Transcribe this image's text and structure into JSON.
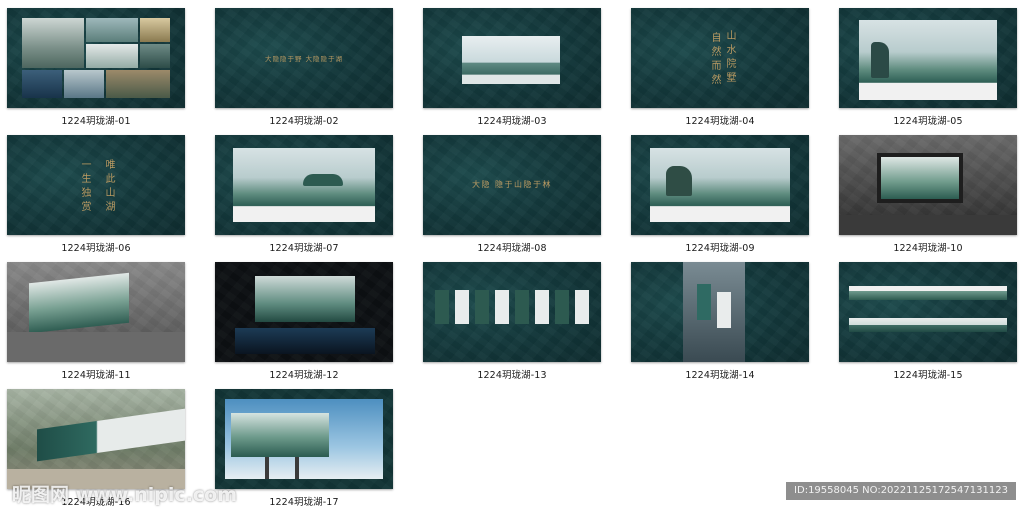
{
  "files": [
    {
      "label": "1224玥珑湖-01"
    },
    {
      "label": "1224玥珑湖-02",
      "text": "大隐隐于野 大隐隐于湖"
    },
    {
      "label": "1224玥珑湖-03"
    },
    {
      "label": "1224玥珑湖-04",
      "col1": "自然而然",
      "col2": "山水院墅"
    },
    {
      "label": "1224玥珑湖-05"
    },
    {
      "label": "1224玥珑湖-06",
      "col1": "一生独赏",
      "col2": "唯此山湖"
    },
    {
      "label": "1224玥珑湖-07"
    },
    {
      "label": "1224玥珑湖-08",
      "text": "大隐 隐于山隐于林"
    },
    {
      "label": "1224玥珑湖-09"
    },
    {
      "label": "1224玥珑湖-10"
    },
    {
      "label": "1224玥珑湖-11"
    },
    {
      "label": "1224玥珑湖-12"
    },
    {
      "label": "1224玥珑湖-13"
    },
    {
      "label": "1224玥珑湖-14"
    },
    {
      "label": "1224玥珑湖-15"
    },
    {
      "label": "1224玥珑湖-16"
    },
    {
      "label": "1224玥珑湖-17"
    }
  ],
  "watermark": "昵图网 www.nipic.com",
  "id_text": "ID:19558045 NO:20221125172547131123",
  "colors": {
    "bg": "#143a3d",
    "gold": "#b99a62",
    "label": "#1a1a1a"
  }
}
